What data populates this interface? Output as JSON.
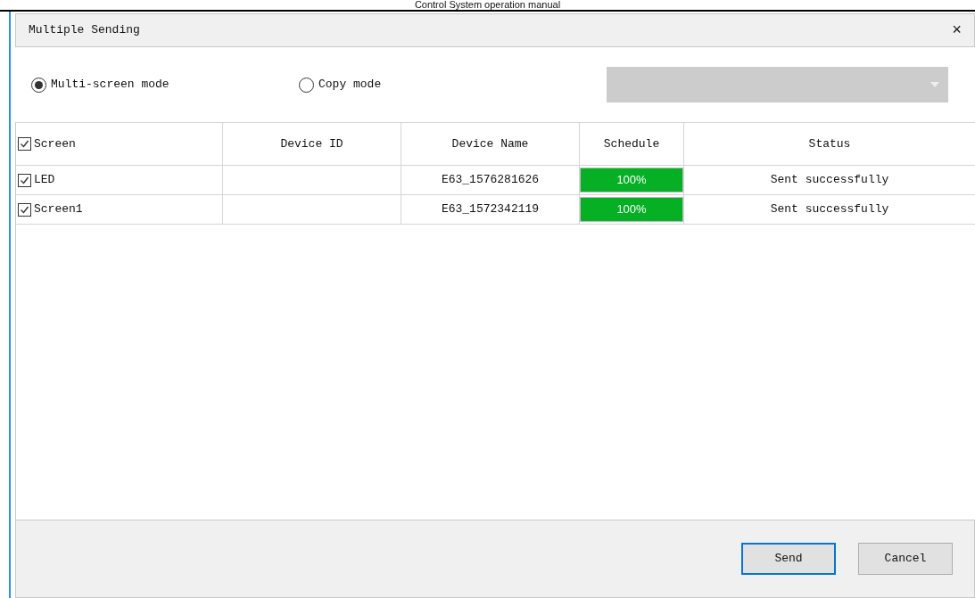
{
  "page_header": "Control System operation manual",
  "window": {
    "title": "Multiple Sending",
    "close": "×"
  },
  "modes": [
    {
      "label": "Multi-screen mode",
      "selected": true
    },
    {
      "label": "Copy mode",
      "selected": false
    }
  ],
  "dropdown": {
    "disabled": true
  },
  "table": {
    "select_all": {
      "label": "Screen",
      "checked": true
    },
    "columns": [
      "Device ID",
      "Device Name",
      "Schedule",
      "Status"
    ],
    "rows": [
      {
        "screen": "LED",
        "checked": true,
        "device_id": "",
        "device_name": "E63_1576281626",
        "level": 1,
        "progress": "100%",
        "status": "Sent successfully"
      },
      {
        "screen": "Screen1",
        "checked": true,
        "device_id": "",
        "device_name": "E63_1572342119",
        "level": 1,
        "progress": "100%",
        "status": "Sent successfully"
      }
    ]
  },
  "buttons": [
    {
      "label": "Send",
      "selected": true
    },
    {
      "label": "Cancel",
      "selected": false
    }
  ]
}
